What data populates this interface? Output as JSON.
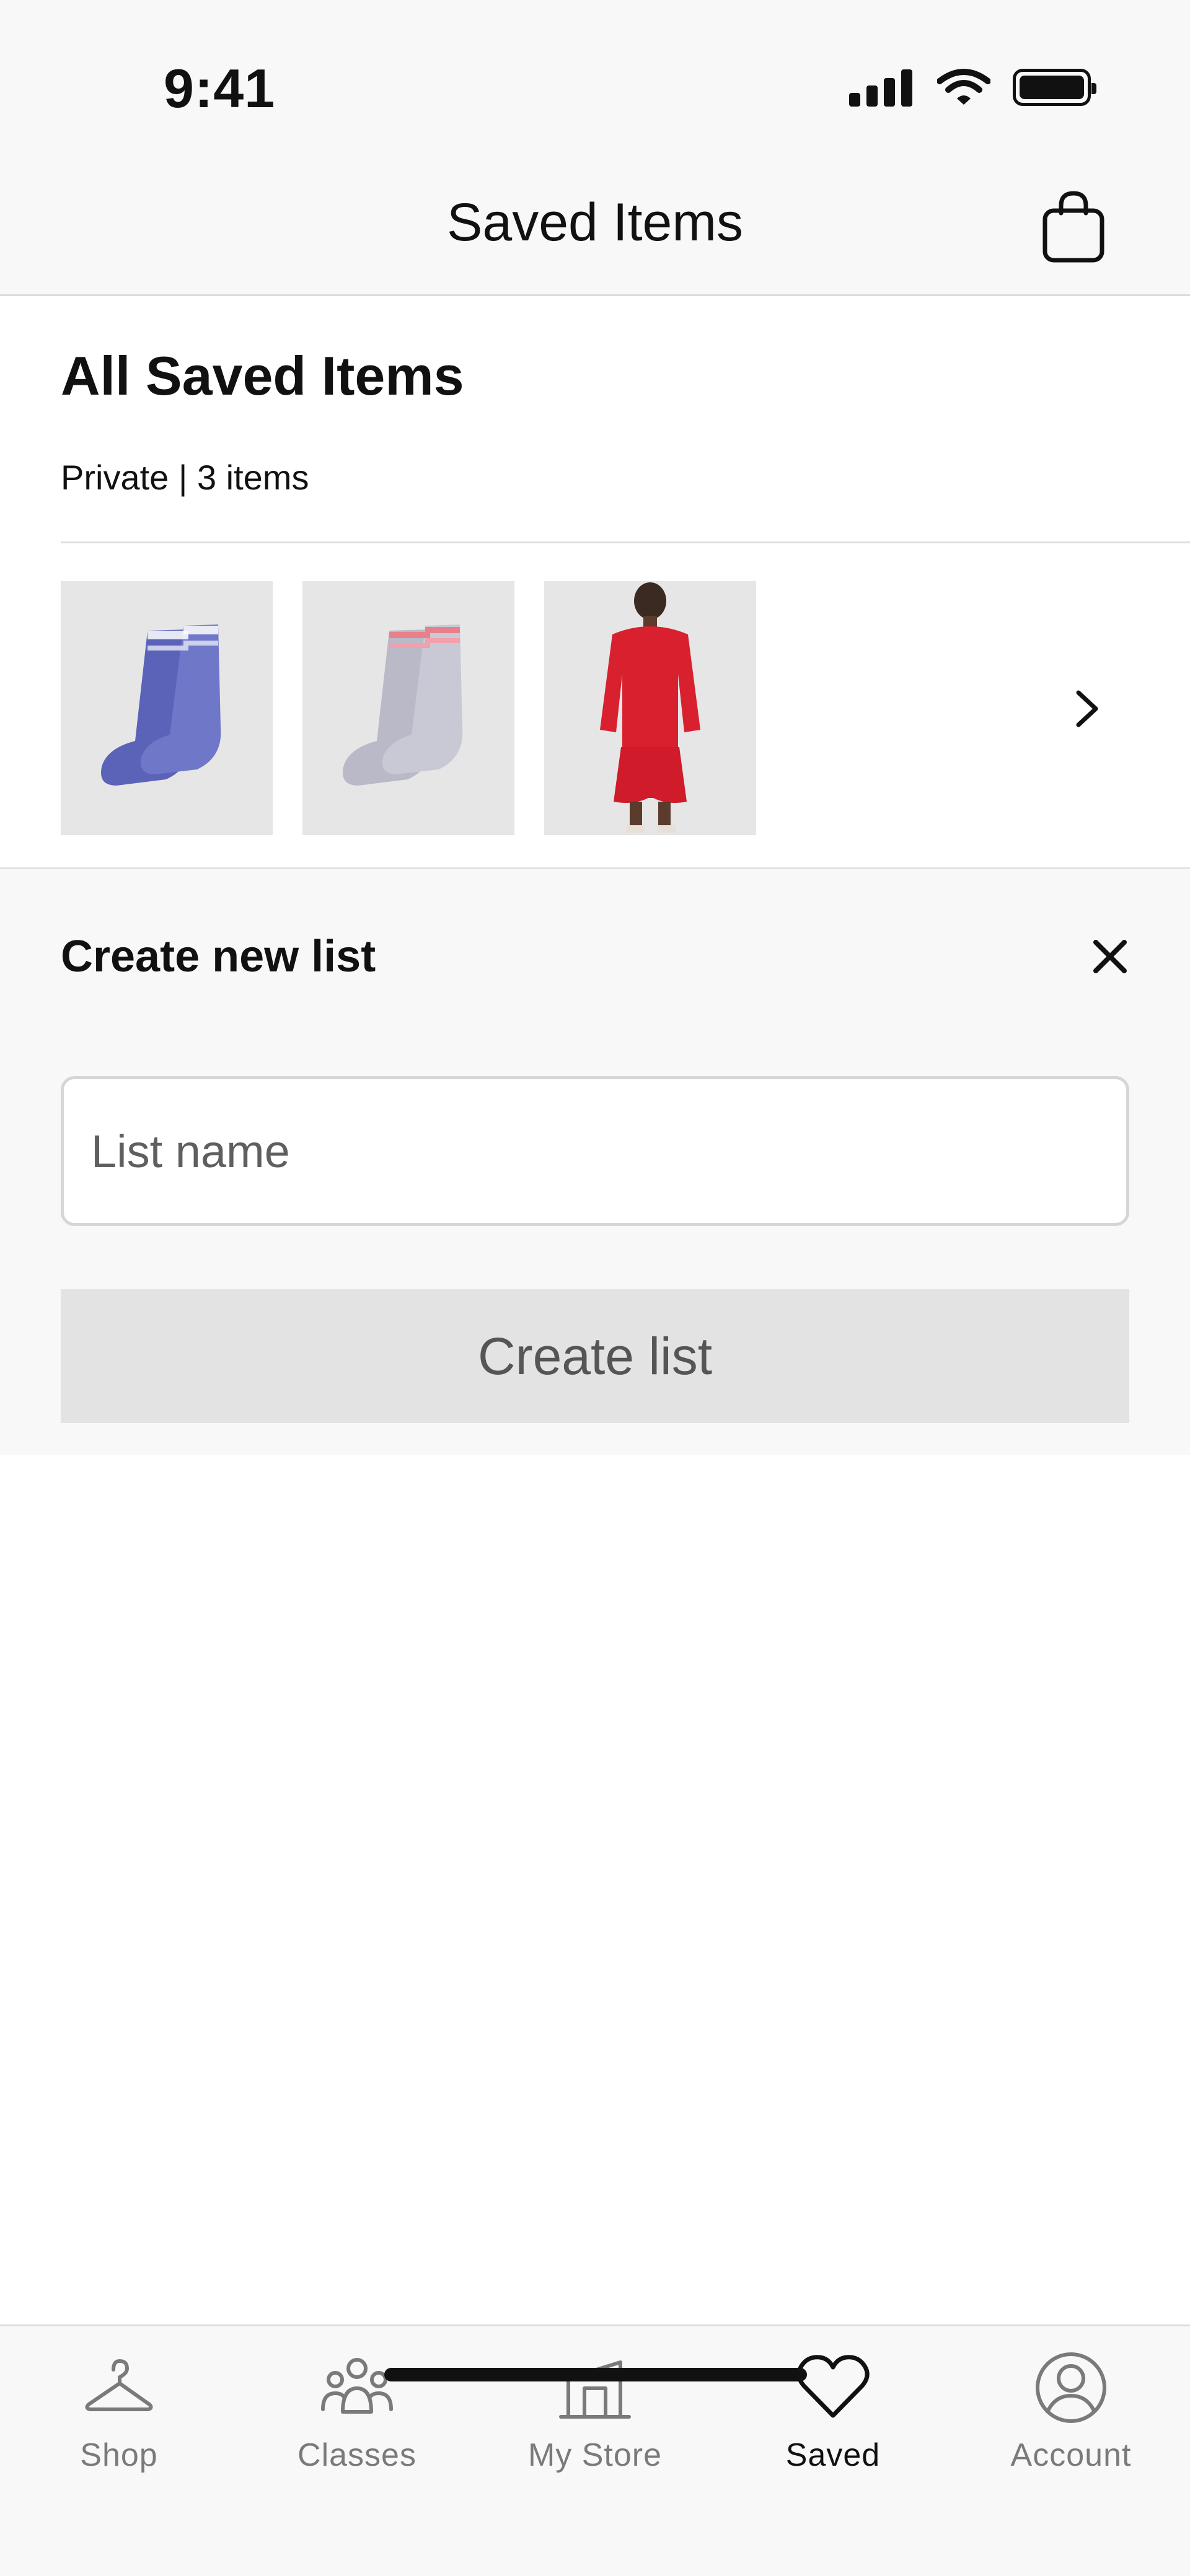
{
  "status_bar": {
    "time": "9:41"
  },
  "nav": {
    "title": "Saved Items",
    "bag_icon": "shopping-bag-icon"
  },
  "saved_list": {
    "title": "All Saved Items",
    "meta": "Private | 3 items",
    "thumbnails": [
      {
        "alt": "Blue striped crew socks"
      },
      {
        "alt": "Grey socks with pink stripes"
      },
      {
        "alt": "Model in red jacket and shorts"
      }
    ]
  },
  "create_list": {
    "title": "Create new list",
    "input_placeholder": "List name",
    "input_value": "",
    "button_label": "Create list"
  },
  "tab_bar": {
    "tabs": [
      {
        "label": "Shop",
        "icon": "hanger-icon",
        "active": false
      },
      {
        "label": "Classes",
        "icon": "people-icon",
        "active": false
      },
      {
        "label": "My Store",
        "icon": "store-icon",
        "active": false
      },
      {
        "label": "Saved",
        "icon": "heart-icon",
        "active": true
      },
      {
        "label": "Account",
        "icon": "account-icon",
        "active": false
      }
    ]
  },
  "colors": {
    "background": "#ffffff",
    "chrome": "#f8f8f8",
    "text": "#111111",
    "muted_text": "#7a7a7a",
    "disabled_button": "#e3e3e3",
    "sock_blue": "#5a63b8",
    "jacket_red": "#d9202f"
  }
}
